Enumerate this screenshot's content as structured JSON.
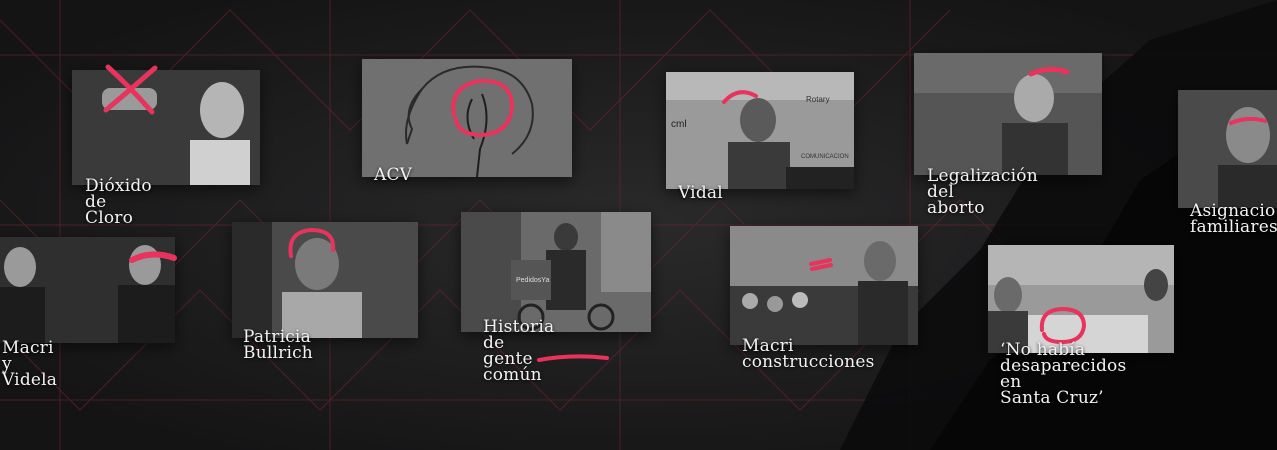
{
  "cards": [
    {
      "id": "dioxido",
      "label": "Dióxido\nde Cloro"
    },
    {
      "id": "acv",
      "label": "ACV"
    },
    {
      "id": "vidal",
      "label": "Vidal"
    },
    {
      "id": "aborto",
      "label": "Legalización del\naborto"
    },
    {
      "id": "asignaciones",
      "label": "Asignacio\nfamiliares"
    },
    {
      "id": "macri-videla",
      "label": "Macri\ny Videla"
    },
    {
      "id": "bullrich",
      "label": "Patricia\nBullrich"
    },
    {
      "id": "historia",
      "label": "Historia de\ngente común"
    },
    {
      "id": "macri-construcciones",
      "label": "Macri\nconstrucciones"
    },
    {
      "id": "desaparecidos",
      "label": "‘No había\ndesaparecidos en\nSanta Cruz’"
    }
  ],
  "photo_text": {
    "vidal_sign_cml": "cml",
    "vidal_sign_rotary": "Rotary",
    "vidal_sign_comunicacion": "COMUNICACION",
    "delivery_box": "PedidosYa"
  },
  "colors": {
    "accent": "#e8335c",
    "background": "#1a1a1b",
    "grid": "#7a2533"
  }
}
